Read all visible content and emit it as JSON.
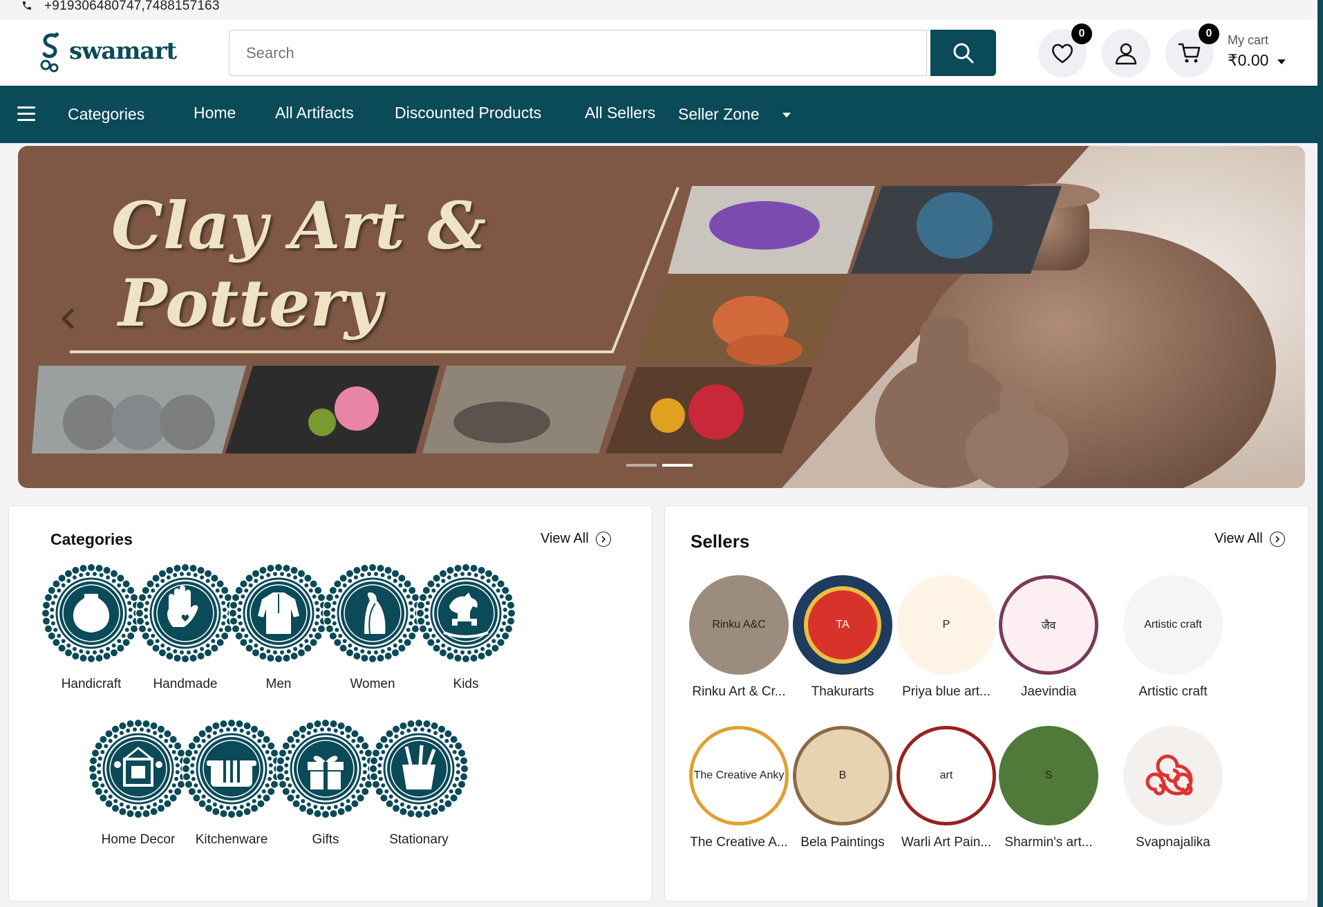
{
  "topbar": {
    "phone": "+919306480747,7488157163",
    "phone_icon": "phone-icon"
  },
  "header": {
    "logo_text": "swamart",
    "search_placeholder": "Search",
    "wishlist_count": "0",
    "cart_count": "0",
    "cart_label": "My cart",
    "cart_total": "₹0.00"
  },
  "nav": {
    "categories": "Categories",
    "home": "Home",
    "all_artifacts": "All Artifacts",
    "discounted": "Discounted Products",
    "all_sellers": "All Sellers",
    "seller_zone": "Seller Zone"
  },
  "banner": {
    "title_line1": "Clay Art &",
    "title_line2": "Pottery",
    "slide_count": 2,
    "active_slide": 2
  },
  "categories_panel": {
    "title": "Categories",
    "view_all": "View All",
    "items": [
      {
        "label": "Handicraft",
        "icon": "vase-icon"
      },
      {
        "label": "Handmade",
        "icon": "hand-icon"
      },
      {
        "label": "Men",
        "icon": "kurta-icon"
      },
      {
        "label": "Women",
        "icon": "saree-icon"
      },
      {
        "label": "Kids",
        "icon": "rocking-horse-icon"
      },
      {
        "label": "Home Decor",
        "icon": "frame-icon"
      },
      {
        "label": "Kitchenware",
        "icon": "utensils-icon"
      },
      {
        "label": "Gifts",
        "icon": "gift-icon"
      },
      {
        "label": "Stationary",
        "icon": "pen-holder-icon"
      }
    ]
  },
  "sellers_panel": {
    "title": "Sellers",
    "view_all": "View All",
    "items": [
      {
        "label": "Rinku Art & Cr...",
        "logo_text": "Rinku A&C"
      },
      {
        "label": "Thakurarts",
        "logo_text": "TA"
      },
      {
        "label": "Priya blue art...",
        "logo_text": "P"
      },
      {
        "label": "Jaevindia",
        "logo_text": "जैव"
      },
      {
        "label": "Artistic craft",
        "logo_text": "Artistic craft"
      },
      {
        "label": "The Creative A...",
        "logo_text": "The Creative Anky"
      },
      {
        "label": "Bela Paintings",
        "logo_text": "B"
      },
      {
        "label": "Warli Art Pain...",
        "logo_text": "art"
      },
      {
        "label": "Sharmin's art...",
        "logo_text": "S"
      },
      {
        "label": "Svapnajalika",
        "logo_text": ""
      }
    ]
  },
  "colors": {
    "brand": "#0b4a58",
    "banner_bg": "#7e5845"
  }
}
